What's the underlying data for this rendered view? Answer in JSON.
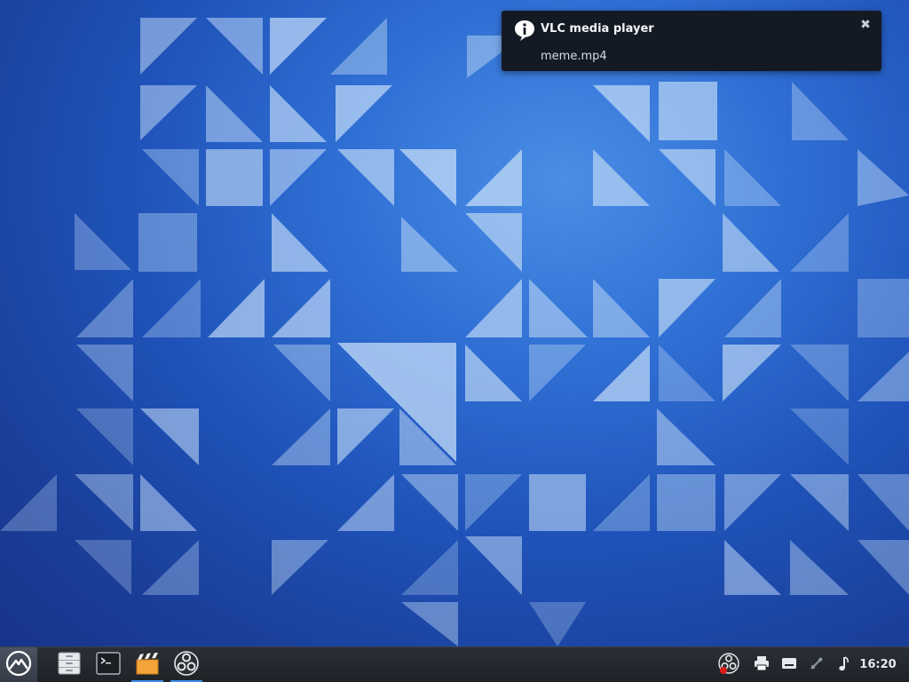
{
  "notification": {
    "title": "VLC media player",
    "body": "meme.mp4",
    "icon": "info-icon",
    "close_icon": "close-icon"
  },
  "taskbar": {
    "start_icon": "mountain-logo-icon",
    "tasks": [
      {
        "name": "files",
        "icon": "file-cabinet-icon",
        "active": false
      },
      {
        "name": "terminal",
        "icon": "terminal-icon",
        "active": false
      },
      {
        "name": "vlc",
        "icon": "clapperboard-icon",
        "active": true
      },
      {
        "name": "obs",
        "icon": "obs-icon",
        "active": true
      }
    ],
    "tray": [
      "obs-recording-icon",
      "printer-icon",
      "keyboard-icon",
      "network-icon",
      "music-note-icon"
    ],
    "clock": "16:20"
  },
  "colors": {
    "desktop_bg": "#2f6fd4",
    "taskbar_bg": "#23272d",
    "notification_bg": "#141a24",
    "active_indicator": "#3d8ee8"
  }
}
